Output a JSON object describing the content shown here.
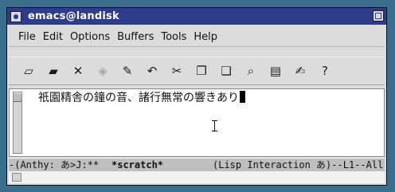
{
  "window": {
    "title": "emacs@landisk"
  },
  "menubar": {
    "items": [
      "File",
      "Edit",
      "Options",
      "Buffers",
      "Tools",
      "Help"
    ]
  },
  "toolbar": {
    "tools": [
      {
        "name": "new-file-icon",
        "glyph": "▱",
        "enabled": true
      },
      {
        "name": "open-folder-icon",
        "glyph": "▰",
        "enabled": true
      },
      {
        "name": "close-icon",
        "glyph": "✕",
        "enabled": true
      },
      {
        "name": "save-disk-icon",
        "glyph": "◈",
        "enabled": false
      },
      {
        "name": "save-as-icon",
        "glyph": "✎",
        "enabled": true
      },
      {
        "name": "undo-icon",
        "glyph": "↶",
        "enabled": true
      },
      {
        "name": "cut-scissors-icon",
        "glyph": "✂",
        "enabled": true
      },
      {
        "name": "copy-icon",
        "glyph": "❐",
        "enabled": true
      },
      {
        "name": "paste-icon",
        "glyph": "❏",
        "enabled": true
      },
      {
        "name": "search-icon",
        "glyph": "⌕",
        "enabled": true
      },
      {
        "name": "print-icon",
        "glyph": "▤",
        "enabled": true
      },
      {
        "name": "preferences-icon",
        "glyph": "✍",
        "enabled": true
      },
      {
        "name": "help-icon",
        "glyph": "?",
        "enabled": true
      }
    ]
  },
  "editor": {
    "text": "祇園精舎の鐘の音、諸行無常の響きあり"
  },
  "modeline": {
    "left": "-(Anthy: あ>J:**",
    "buffer": "*scratch*",
    "right": "(Lisp Interaction あ)--L1--All-"
  },
  "colors": {
    "desktop": "#3a6e8f",
    "titlebar": "#2f3c8a",
    "window_bg": "#dcdcdc",
    "modeline_bg": "#bfbfbf"
  }
}
